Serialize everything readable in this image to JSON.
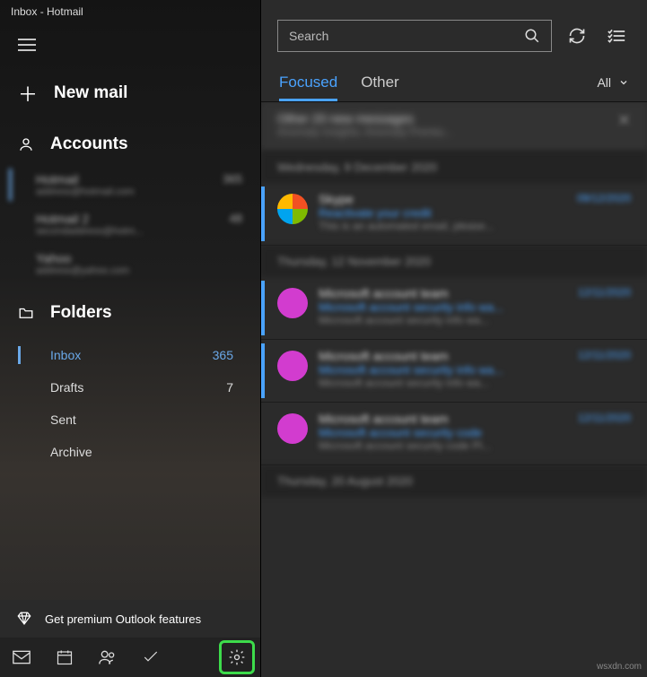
{
  "window": {
    "title": "Inbox - Hotmail"
  },
  "sidebar": {
    "new_mail": "New mail",
    "accounts_header": "Accounts",
    "accounts": [
      {
        "name": "Hotmail",
        "sub": "address@hotmail.com",
        "badge": "365",
        "selected": true
      },
      {
        "name": "Hotmail 2",
        "sub": "secondaddress@hotm...",
        "badge": "48",
        "selected": false
      },
      {
        "name": "Yahoo",
        "sub": "address@yahoo.com",
        "badge": "",
        "selected": false
      }
    ],
    "folders_header": "Folders",
    "folders": [
      {
        "label": "Inbox",
        "count": "365",
        "selected": true
      },
      {
        "label": "Drafts",
        "count": "7",
        "selected": false
      },
      {
        "label": "Sent",
        "count": "",
        "selected": false
      },
      {
        "label": "Archive",
        "count": "",
        "selected": false
      }
    ],
    "premium": "Get premium Outlook features"
  },
  "toolbar": {
    "search_placeholder": "Search",
    "tabs": {
      "focused": "Focused",
      "other": "Other"
    },
    "filter_label": "All"
  },
  "messages": {
    "summary": {
      "line1": "Other 20 new messages",
      "line2": "Anomaly Insights; Anomaly Premiu..."
    },
    "groups": [
      {
        "header": "Wednesday, 9 December 2020",
        "items": [
          {
            "avatar": "multicolor",
            "sender": "Skype",
            "subject": "Reactivate your credit",
            "preview": "This is an automated email, please...",
            "date": "09/12/2020",
            "unread": true
          }
        ]
      },
      {
        "header": "Thursday, 12 November 2020",
        "items": [
          {
            "avatar": "magenta",
            "sender": "Microsoft account team",
            "subject": "Microsoft account security info wa...",
            "preview": "Microsoft account security info wa...",
            "date": "12/11/2020",
            "unread": true
          },
          {
            "avatar": "magenta",
            "sender": "Microsoft account team",
            "subject": "Microsoft account security info wa...",
            "preview": "Microsoft account security info wa...",
            "date": "12/11/2020",
            "unread": true
          },
          {
            "avatar": "magenta",
            "sender": "Microsoft account team",
            "subject": "Microsoft account security code",
            "preview": "Microsoft account security code Pl...",
            "date": "12/11/2020",
            "unread": false
          }
        ]
      },
      {
        "header": "Thursday, 20 August 2020",
        "items": []
      }
    ]
  },
  "watermark": "wsxdn.com"
}
